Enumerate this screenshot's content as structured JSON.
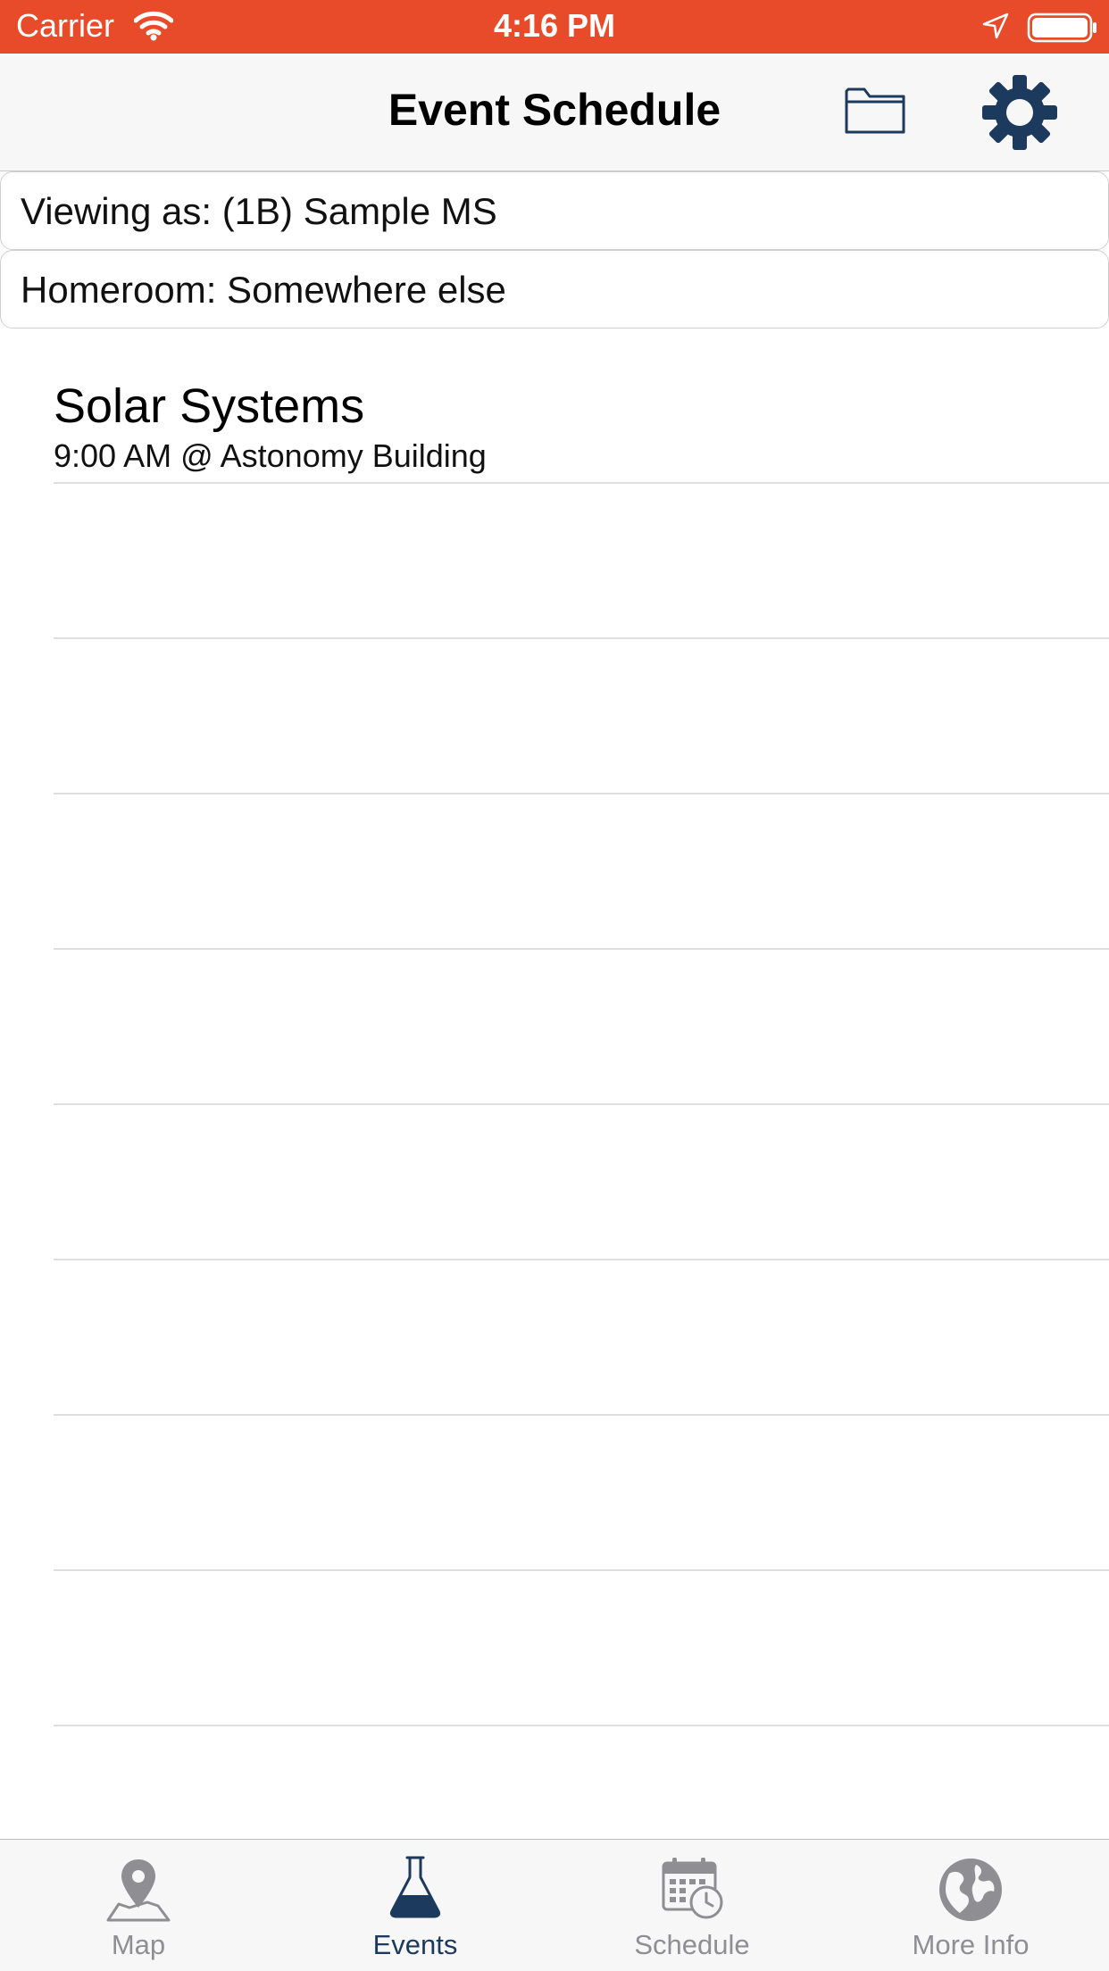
{
  "status_bar": {
    "carrier": "Carrier",
    "time": "4:16 PM",
    "wifi_icon": "wifi-icon",
    "location_icon": "location-arrow-icon",
    "battery_icon": "battery-full-icon",
    "background_color": "#e84b2a"
  },
  "nav_bar": {
    "title": "Event Schedule",
    "folder_icon": "folder-icon",
    "gear_icon": "gear-icon",
    "icon_color": "#1c3a5e"
  },
  "info": {
    "viewing_as": "Viewing as: (1B) Sample MS",
    "homeroom": "Homeroom: Somewhere else"
  },
  "events": [
    {
      "title": "Solar Systems",
      "subtitle": "9:00 AM @ Astonomy Building"
    },
    {
      "title": "",
      "subtitle": ""
    },
    {
      "title": "",
      "subtitle": ""
    },
    {
      "title": "",
      "subtitle": ""
    },
    {
      "title": "",
      "subtitle": ""
    },
    {
      "title": "",
      "subtitle": ""
    },
    {
      "title": "",
      "subtitle": ""
    },
    {
      "title": "",
      "subtitle": ""
    },
    {
      "title": "",
      "subtitle": ""
    }
  ],
  "tab_bar": {
    "tabs": [
      {
        "label": "Map",
        "icon": "map-pin-icon",
        "active": false
      },
      {
        "label": "Events",
        "icon": "flask-icon",
        "active": true
      },
      {
        "label": "Schedule",
        "icon": "calendar-clock-icon",
        "active": false
      },
      {
        "label": "More Info",
        "icon": "globe-icon",
        "active": false
      }
    ],
    "active_color": "#1c3a5e",
    "inactive_color": "#8e8e93"
  }
}
